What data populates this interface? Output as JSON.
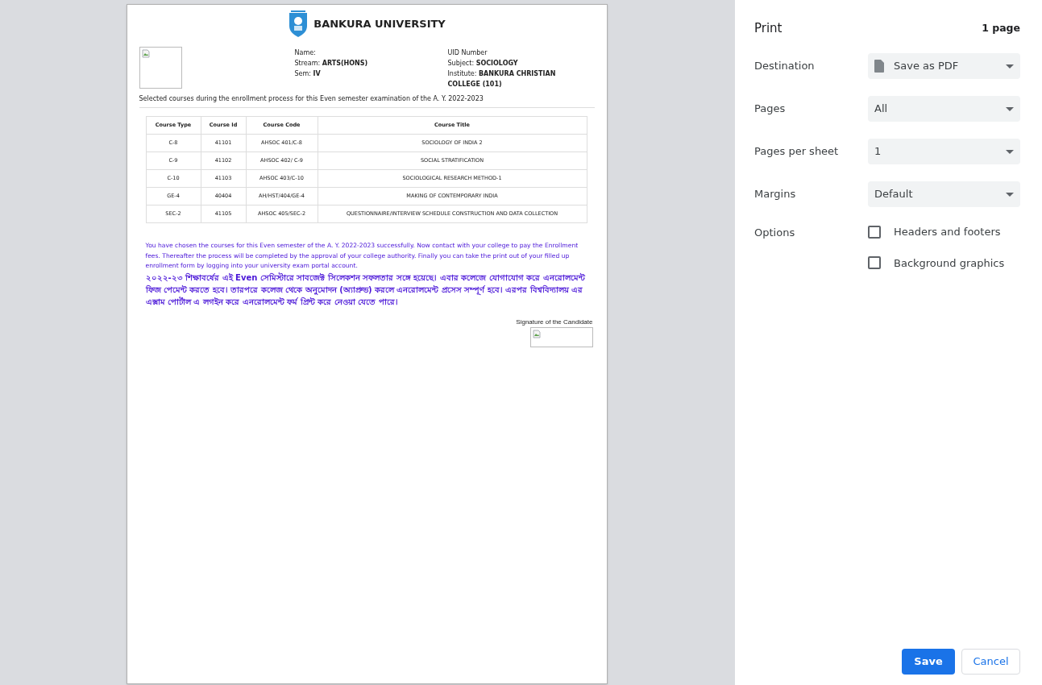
{
  "document": {
    "title": "BANKURA UNIVERSITY",
    "fields_middle": [
      {
        "label": "Name:"
      },
      {
        "label": "Stream:",
        "value": "ARTS(HONS)"
      },
      {
        "label": "Sem:",
        "value": "IV"
      }
    ],
    "fields_right": [
      {
        "label": "UID Number"
      },
      {
        "label": "Subject:",
        "value": "SOCIOLOGY"
      },
      {
        "label": "Institute:",
        "value": "BANKURA CHRISTIAN COLLEGE (101)"
      }
    ],
    "intro": "Selected courses during the enrollment process for this Even semester examination of the A. Y. 2022-2023",
    "table": {
      "columns": [
        "Course Type",
        "Course Id",
        "Course Code",
        "Course Title"
      ],
      "rows": [
        [
          "C-8",
          "41101",
          "AHSOC 401/C-8",
          "SOCIOLOGY OF INDIA 2"
        ],
        [
          "C-9",
          "41102",
          "AHSOC 402/ C-9",
          "SOCIAL STRATIFICATION"
        ],
        [
          "C-10",
          "41103",
          "AHSOC 403/C-10",
          "SOCIOLOGICAL RESEARCH METHOD-1"
        ],
        [
          "GE-4",
          "40404",
          "AH/HST/404/GE-4",
          "MAKING OF CONTEMPORARY INDIA"
        ],
        [
          "SEC-2",
          "41105",
          "AHSOC 405/SEC-2",
          "QUESTIONNAIRE/INTERVIEW SCHEDULE CONSTRUCTION AND DATA COLLECTION"
        ]
      ]
    },
    "message_en": "You have chosen the courses for this Even semester of the A. Y. 2022-2023 successfully. Now contact with your college to pay the Enrollment fees. Thereafter the process will be completed by the approval of your college authority. Finally you can take the print out of your filled up enrollment form by logging into your university exam portal account.",
    "message_bn": "২০২২-২৩ শিক্ষাবর্ষের এই Even সেমিস্টারে সাবজেক্ট সিলেকশন সফলতার সঙ্গে হয়েছে। এবার কলেজে যোগাযোগ করে এনরোলমেন্ট ফিজ পেমেন্ট করতে হবে। তারপরে কলেজ থেকে অনুমোদন (অ্যাপ্রুভ) করলে এনরোলমেন্ট প্রসেস সম্পূর্ণ হবে। এরপর বিশ্ববিদ্যালয় এর এক্সাম পোর্টাল এ লগইন করে এনরোলমেন্ট ফর্ম প্রিন্ট করে নেওয়া যেতে পারে।",
    "signature_label": "Signature of the Candidate"
  },
  "print_panel": {
    "title": "Print",
    "page_count": "1 page",
    "settings": [
      {
        "label": "Destination",
        "value": "Save as PDF",
        "kind": "destination"
      },
      {
        "label": "Pages",
        "value": "All",
        "kind": "select"
      },
      {
        "label": "Pages per sheet",
        "value": "1",
        "kind": "select"
      },
      {
        "label": "Margins",
        "value": "Default",
        "kind": "select"
      }
    ],
    "options": {
      "label": "Options",
      "items": [
        {
          "label": "Headers and footers",
          "checked": false
        },
        {
          "label": "Background graphics",
          "checked": false
        }
      ]
    },
    "buttons": [
      {
        "label": "Save",
        "kind": "primary"
      },
      {
        "label": "Cancel",
        "kind": "secondary"
      }
    ]
  }
}
